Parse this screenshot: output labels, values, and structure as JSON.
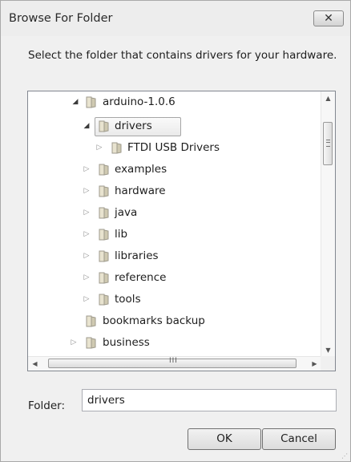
{
  "window": {
    "title": "Browse For Folder",
    "close_glyph": "✕"
  },
  "instruction": "Select the folder that contains drivers for your hardware.",
  "tree": {
    "items": [
      {
        "label": "arduino-1.0.6",
        "expanded": true
      },
      {
        "label": "drivers",
        "expanded": true,
        "selected": true
      },
      {
        "label": "FTDI USB Drivers",
        "expanded": false
      },
      {
        "label": "examples",
        "expanded": false
      },
      {
        "label": "hardware",
        "expanded": false
      },
      {
        "label": "java",
        "expanded": false
      },
      {
        "label": "lib",
        "expanded": false
      },
      {
        "label": "libraries",
        "expanded": false
      },
      {
        "label": "reference",
        "expanded": false
      },
      {
        "label": "tools",
        "expanded": false
      },
      {
        "label": "bookmarks backup",
        "expanded": null
      },
      {
        "label": "business",
        "expanded": false
      }
    ],
    "icons": {
      "expanded": "triangle-down-icon",
      "collapsed": "triangle-right-icon",
      "folder": "folder-icon"
    }
  },
  "scroll": {
    "v_up": "▲",
    "v_down": "▼",
    "h_left": "◀",
    "h_right": "▶",
    "h_grip": "III"
  },
  "folder_field": {
    "label": "Folder:",
    "value": "drivers"
  },
  "buttons": {
    "ok": "OK",
    "cancel": "Cancel"
  },
  "colors": {
    "dialog_bg": "#f0f0f0",
    "selection_border": "#a6a6a6",
    "folder_fill": "#e8e3cf"
  }
}
